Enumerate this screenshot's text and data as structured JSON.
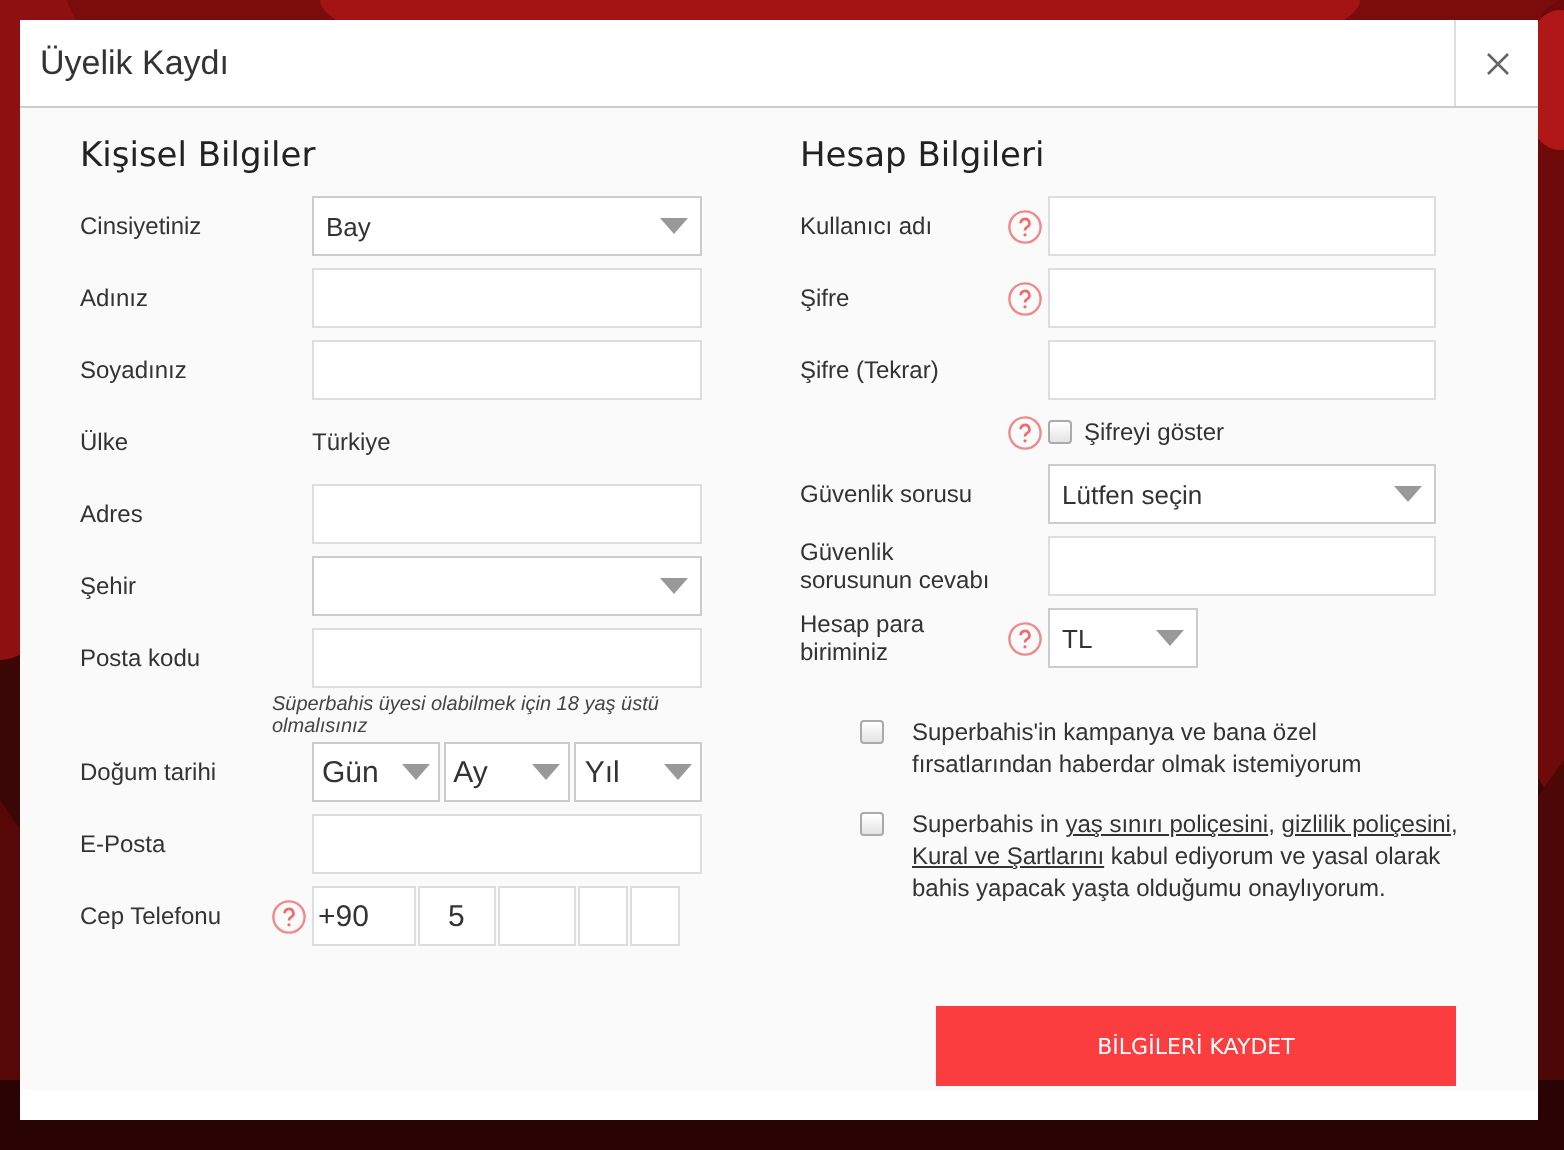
{
  "dialog": {
    "title": "Üyelik Kaydı"
  },
  "personal": {
    "heading": "Kişisel Bilgiler",
    "rows": [
      {
        "kind": "select",
        "label": "Cinsiyetiniz",
        "value": "Bay"
      },
      {
        "kind": "input",
        "label": "Adınız"
      },
      {
        "kind": "input",
        "label": "Soyadınız"
      },
      {
        "kind": "text",
        "label": "Ülke",
        "value": "Türkiye"
      },
      {
        "kind": "input",
        "label": "Adres"
      },
      {
        "kind": "select",
        "label": "Şehir"
      },
      {
        "kind": "input",
        "label": "Posta kodu"
      },
      {
        "kind": "note",
        "text": "Süperbahis üyesi olabilmek için 18 yaş üstü olmalısınız"
      },
      {
        "kind": "date",
        "label": "Doğum tarihi",
        "parts": [
          {
            "value": "Gün"
          },
          {
            "value": "Ay"
          },
          {
            "value": "Yıl"
          }
        ]
      },
      {
        "kind": "input",
        "label": "E-Posta"
      },
      {
        "kind": "phone",
        "label": "Cep Telefonu",
        "help": true,
        "parts": [
          {
            "kind": "filled",
            "value": "+90"
          },
          {
            "kind": "filled",
            "value": "5"
          },
          {
            "kind": "empty"
          },
          {
            "kind": "empty"
          },
          {
            "kind": "empty"
          }
        ]
      }
    ]
  },
  "account": {
    "heading": "Hesap Bilgileri",
    "rows": [
      {
        "kind": "input",
        "label": "Kullanıcı adı",
        "help": true
      },
      {
        "kind": "input",
        "label": "Şifre",
        "help": true
      },
      {
        "kind": "input",
        "label": "Şifre (Tekrar)"
      },
      {
        "kind": "checkbox",
        "help": true,
        "text": "Şifreyi göster",
        "checked": false
      },
      {
        "kind": "select",
        "label": "Güvenlik sorusu",
        "value": "Lütfen seçin"
      },
      {
        "kind": "input",
        "label": "Güvenlik sorusunun cevabı"
      },
      {
        "kind": "small-select",
        "label": "Hesap para biriminiz",
        "help": true,
        "value": "TL"
      }
    ]
  },
  "consents": [
    {
      "checked": false,
      "segments": [
        {
          "text": "Superbahis'in kampanya ve bana özel fırsatlarından haberdar olmak istemiyorum"
        }
      ]
    },
    {
      "checked": false,
      "segments": [
        {
          "text": "Superbahis in "
        },
        {
          "text": "yaş sınırı poliçesini",
          "link": true
        },
        {
          "text": ", "
        },
        {
          "text": "gizlilik poliçesini",
          "link": true
        },
        {
          "text": ", "
        },
        {
          "text": "Kural ve Şartlarını",
          "link": true
        },
        {
          "text": " kabul ediyorum ve yasal olarak bahis yapacak yaşta olduğumu onaylıyorum."
        }
      ]
    }
  ],
  "submit": {
    "label": "BİLGİLERİ KAYDET"
  }
}
